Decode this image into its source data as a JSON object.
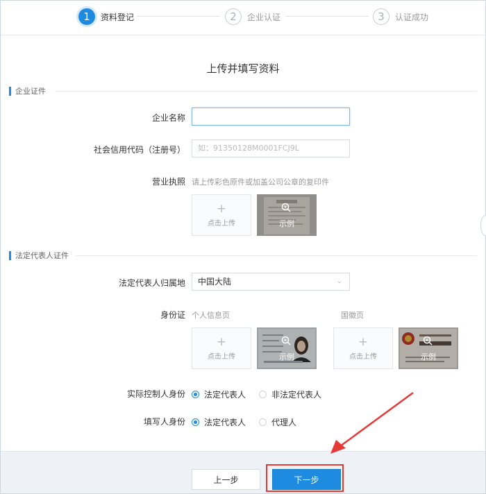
{
  "steps": [
    {
      "num": "1",
      "label": "资料登记"
    },
    {
      "num": "2",
      "label": "企业认证"
    },
    {
      "num": "3",
      "label": "认证成功"
    }
  ],
  "page_title": "上传并填写资料",
  "company_section": {
    "title": "企业证件",
    "name_label": "企业名称",
    "name_value": "",
    "credit_label": "社会信用代码（注册号）",
    "credit_placeholder": "如：91350128M0001FCJ9L",
    "license_label": "营业执照",
    "license_hint": "请上传彩色原件或加盖公司公章的复印件",
    "upload_text": "点击上传",
    "sample_text": "示例"
  },
  "legal_section": {
    "title": "法定代表人证件",
    "region_label": "法定代表人归属地",
    "region_value": "中国大陆",
    "id_label": "身份证",
    "id_front_hint": "个人信息页",
    "id_back_hint": "国徽页",
    "upload_text": "点击上传",
    "sample_text": "示例",
    "controller_label": "实际控制人身份",
    "controller_options": [
      "法定代表人",
      "非法定代表人"
    ],
    "controller_selected": "法定代表人",
    "filler_label": "填写人身份",
    "filler_options": [
      "法定代表人",
      "代理人"
    ],
    "filler_selected": "法定代表人"
  },
  "buttons": {
    "prev": "上一步",
    "next": "下一步"
  },
  "colors": {
    "accent": "#1e8be0",
    "highlight": "#e53935"
  }
}
